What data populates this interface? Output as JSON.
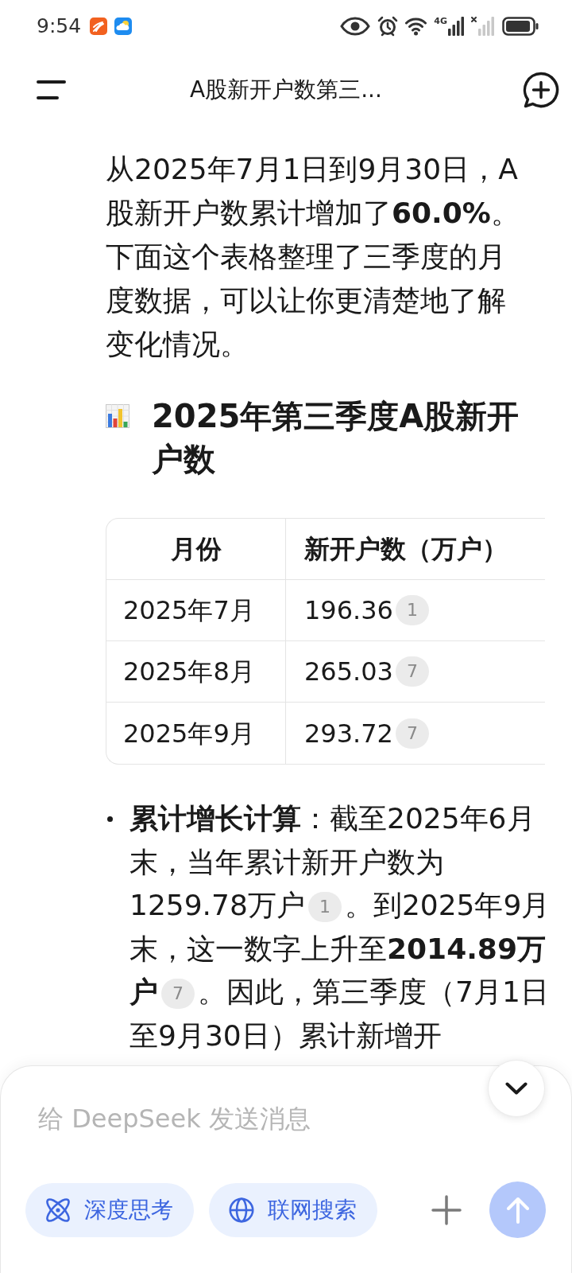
{
  "status_bar": {
    "time": "9:54",
    "network_type": "4G"
  },
  "header": {
    "title": "A股新开户数第三..."
  },
  "message": {
    "paragraph": "从2025年7月1日到9月30日，A股新开户数累计增加了**60.0%**。下面这个表格整理了三季度的月度数据，可以让你更清楚地了解变化情况。",
    "heading": "2025年第三季度A股新开户数",
    "table": {
      "columns": [
        "月份",
        "新开户数（万户）"
      ],
      "rows": [
        {
          "cells": [
            {
              "text": "2025年7月"
            },
            {
              "text": "196.36",
              "citation": "1"
            }
          ]
        },
        {
          "cells": [
            {
              "text": "2025年8月"
            },
            {
              "text": "265.03",
              "citation": "7"
            }
          ]
        },
        {
          "cells": [
            {
              "text": "2025年9月"
            },
            {
              "text": "293.72",
              "citation": "7"
            }
          ]
        }
      ]
    },
    "bullets": [
      {
        "segments": [
          {
            "kind": "text",
            "text": "**累计增长计算**：截至2025年6月末，当年累计新开户数为1259.78万户"
          },
          {
            "kind": "citation",
            "label": "1"
          },
          {
            "kind": "text",
            "text": "。到2025年9月末，这一数字上升至**2014.89万户**"
          },
          {
            "kind": "citation",
            "label": "7"
          },
          {
            "kind": "text",
            "text": "。因此，第三季度（7月1日至9月30日）累计新增开"
          }
        ]
      }
    ]
  },
  "composer": {
    "placeholder": "给 DeepSeek 发送消息"
  },
  "toggles": [
    {
      "kind": "deep-think",
      "label": "深度思考",
      "on": true
    },
    {
      "kind": "web-search",
      "label": "联网搜索",
      "on": true
    }
  ],
  "send_button": {
    "disabled": true
  }
}
